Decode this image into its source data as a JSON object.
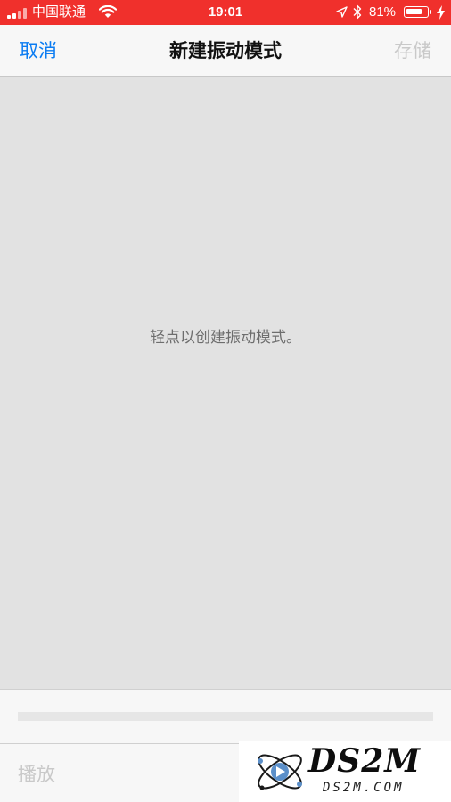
{
  "status_bar": {
    "carrier": "中国联通",
    "time": "19:01",
    "battery_percent": "81%",
    "battery_level": 0.81,
    "background": "#f0302c",
    "icons": [
      "signal-icon",
      "wifi-icon",
      "location-icon",
      "bluetooth-icon",
      "battery-icon",
      "charging-icon"
    ]
  },
  "nav_bar": {
    "cancel_label": "取消",
    "title": "新建振动模式",
    "save_label": "存储",
    "accent": "#0b7cf2"
  },
  "tap_area": {
    "hint": "轻点以创建振动模式。"
  },
  "toolbar": {
    "play_label": "播放"
  },
  "watermark": {
    "name": "DS2M",
    "url": "DS2M.COM"
  }
}
